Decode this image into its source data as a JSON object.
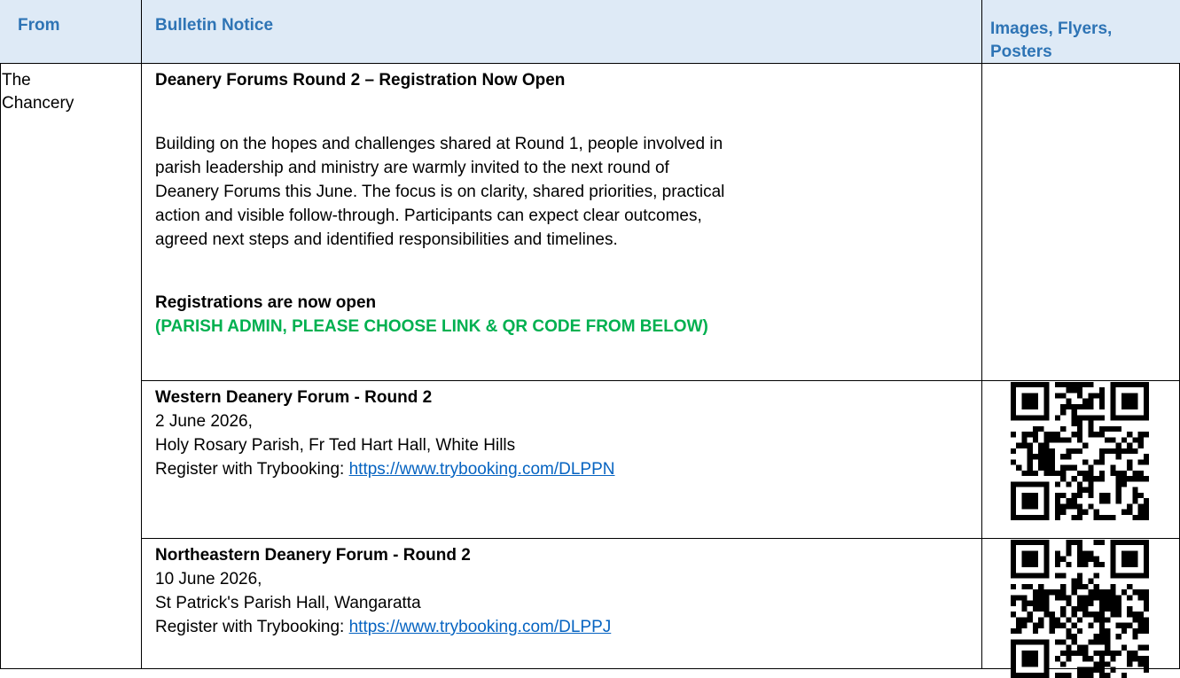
{
  "header": {
    "from": "From",
    "notice": "Bulletin Notice",
    "images": "Images, Flyers, Posters"
  },
  "from_cell": {
    "line1": "The",
    "line2": "Chancery"
  },
  "main_notice": {
    "title": "Deanery Forums Round 2 – Registration Now Open",
    "body_lines": [
      "Building on the hopes and challenges shared at Round 1, people involved in",
      "parish leadership and ministry are warmly invited to the next round of",
      "Deanery Forums this June. The focus is on clarity, shared priorities, practical",
      "action and visible follow-through. Participants can expect clear outcomes,",
      "agreed next steps and identified responsibilities and timelines."
    ],
    "registrations": "Registrations are now open",
    "admin_note": "(PARISH ADMIN, PLEASE CHOOSE LINK & QR CODE FROM BELOW)"
  },
  "events": [
    {
      "title": "Western Deanery Forum - Round 2",
      "date": "2 June 2026,",
      "venue": "Holy Rosary Parish, Fr Ted Hart Hall, White Hills",
      "register_prefix": "Register with Trybooking: ",
      "link": "https://www.trybooking.com/DLPPN",
      "qr_icon": "qr-code-icon"
    },
    {
      "title": "Northeastern Deanery Forum - Round 2",
      "date": "10 June 2026,",
      "venue": "St Patrick's Parish Hall, Wangaratta",
      "register_prefix": "Register with Trybooking: ",
      "link": "https://www.trybooking.com/DLPPJ",
      "qr_icon": "qr-code-icon"
    }
  ],
  "colors": {
    "header_bg": "#deeaf6",
    "header_text": "#2e74b5",
    "green": "#00b050",
    "link": "#0563c1"
  }
}
